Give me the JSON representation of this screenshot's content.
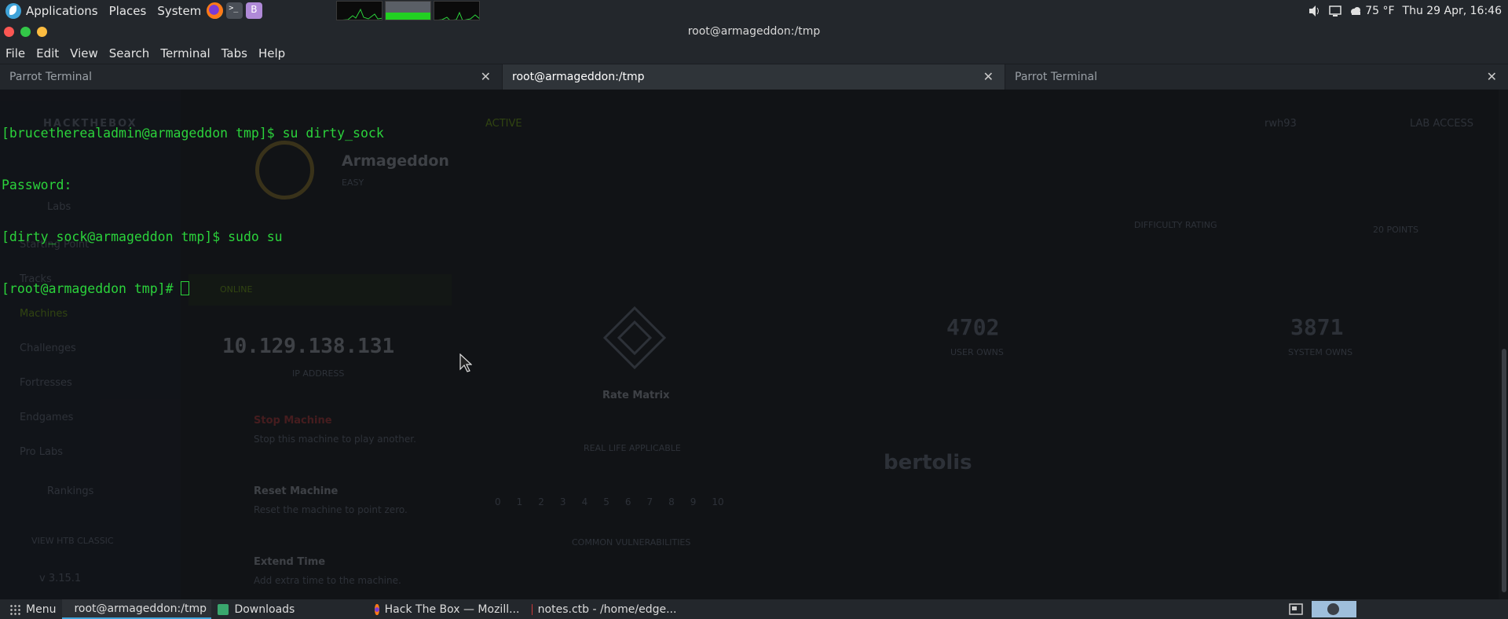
{
  "top_panel": {
    "applications": "Applications",
    "places": "Places",
    "system": "System",
    "temperature": "75 °F",
    "clock": "Thu 29 Apr, 16:46"
  },
  "window": {
    "title": "root@armageddon:/tmp"
  },
  "menu": [
    "File",
    "Edit",
    "View",
    "Search",
    "Terminal",
    "Tabs",
    "Help"
  ],
  "tabs": [
    {
      "label": "Parrot Terminal",
      "active": false
    },
    {
      "label": "root@armageddon:/tmp",
      "active": true
    },
    {
      "label": "Parrot Terminal",
      "active": false
    }
  ],
  "terminal": {
    "lines": [
      "[brucetherealadmin@armageddon tmp]$ su dirty_sock",
      "Password:",
      "[dirty_sock@armageddon tmp]$ sudo su",
      "[root@armageddon tmp]# "
    ]
  },
  "background_page": {
    "brand": "HACKTHEBOX",
    "status": "ACTIVE",
    "machine_name": "Armageddon",
    "difficulty": "EASY",
    "online": "ONLINE",
    "ip_address": "10.129.138.131",
    "ip_label": "IP ADDRESS",
    "stop_machine": "Stop Machine",
    "stop_desc": "Stop this machine to play another.",
    "reset_machine": "Reset Machine",
    "reset_desc": "Reset the machine to point zero.",
    "extend_time": "Extend Time",
    "extend_desc": "Add extra time to the machine.",
    "rate_matrix": "Rate Matrix",
    "real_life": "REAL LIFE APPLICABLE",
    "common_vulns": "COMMON VULNERABILITIES",
    "user_owns": "4702",
    "user_owns_label": "USER OWNS",
    "system_owns": "3871",
    "system_owns_label": "SYSTEM OWNS",
    "difficulty_rating": "DIFFICULTY RATING",
    "points": "20 POINTS",
    "creator": "bertolis",
    "user": "rwh93",
    "lab_access": "LAB ACCESS",
    "version": "v 3.15.1",
    "view_classic": "VIEW HTB CLASSIC",
    "sidebar": [
      "Labs",
      "Starting Point",
      "Tracks",
      "Machines",
      "Challenges",
      "Fortresses",
      "Endgames",
      "Pro Labs",
      "Rankings"
    ],
    "scale": [
      "0",
      "1",
      "2",
      "3",
      "4",
      "5",
      "6",
      "7",
      "8",
      "9",
      "10"
    ]
  },
  "bottom_panel": {
    "menu": "Menu",
    "tasks": [
      {
        "label": "root@armageddon:/tmp",
        "icon": "terminal-icon",
        "active": true
      },
      {
        "label": "Downloads",
        "icon": "folder-icon",
        "active": false
      },
      {
        "label": "Hack The Box — Mozill...",
        "icon": "firefox-icon",
        "active": false
      },
      {
        "label": "notes.ctb - /home/edge...",
        "icon": "cherrytree-icon",
        "active": false
      }
    ]
  },
  "colors": {
    "panel": "#23272c",
    "terminal_bg": "#111316",
    "terminal_fg": "#2bd33b",
    "accent": "#3fa3d8"
  }
}
